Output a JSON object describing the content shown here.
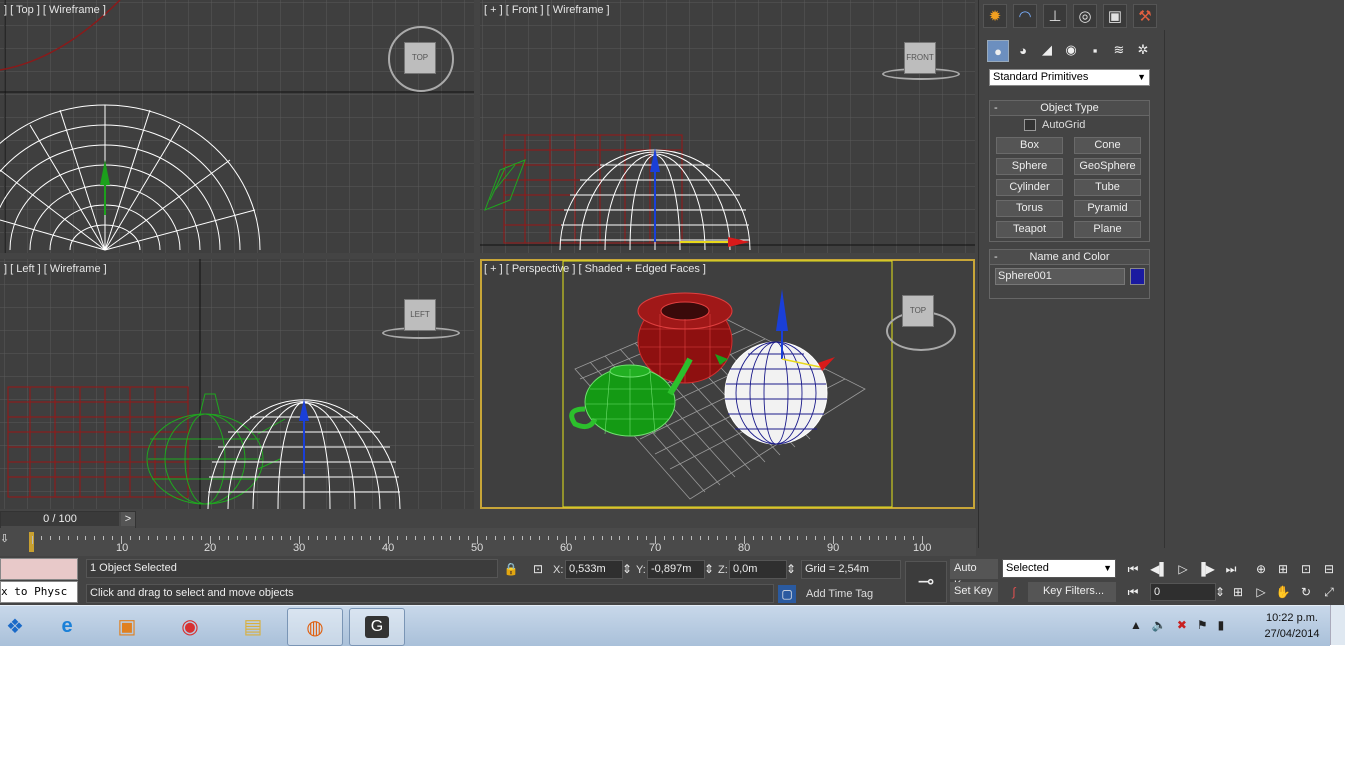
{
  "viewports": {
    "top": {
      "label": "] [ Top ] [ Wireframe ]",
      "cube": "TOP"
    },
    "front": {
      "label": "[ + ] [ Front ] [ Wireframe ]",
      "cube": "FRONT"
    },
    "left": {
      "label": "] [ Left ] [ Wireframe ]",
      "cube": "LEFT"
    },
    "perspective": {
      "label": "[ + ] [ Perspective ] [ Shaded + Edged Faces ]",
      "cube": "TOP"
    }
  },
  "command_panel": {
    "tabs": [
      "create-icon",
      "modify-icon",
      "hierarchy-icon",
      "motion-icon",
      "display-icon",
      "utilities-icon"
    ],
    "subtabs": [
      "geometry-icon",
      "shapes-icon",
      "lights-icon",
      "cameras-icon",
      "helpers-icon",
      "spacewarps-icon",
      "systems-icon"
    ],
    "dropdown": "Standard Primitives",
    "object_type": {
      "title": "Object Type",
      "autogrid": "AutoGrid",
      "buttons": [
        "Box",
        "Cone",
        "Sphere",
        "GeoSphere",
        "Cylinder",
        "Tube",
        "Torus",
        "Pyramid",
        "Teapot",
        "Plane"
      ]
    },
    "name_color": {
      "title": "Name and Color",
      "name": "Sphere001",
      "color": "#1a1aa0"
    }
  },
  "timeline": {
    "slider": "0 / 100",
    "next": ">",
    "labels": [
      "10",
      "20",
      "30",
      "40",
      "50",
      "60",
      "70",
      "80",
      "90",
      "100"
    ]
  },
  "status": {
    "script": "x to Physc",
    "selected": "1 Object Selected",
    "prompt": "Click and drag to select and move objects",
    "x_label": "X:",
    "x": "0,533m",
    "y_label": "Y:",
    "y": "-0,897m",
    "z_label": "Z:",
    "z": "0,0m",
    "grid": "Grid = 2,54m",
    "add_time_tag": "Add Time Tag",
    "auto_key": "Auto Key",
    "set_key": "Set Key",
    "key_mode": "Selected",
    "key_filters": "Key Filters...",
    "frame": "0"
  },
  "taskbar": {
    "apps": [
      "start-icon",
      "ie-icon",
      "media-icon",
      "chrome-icon",
      "explorer-icon",
      "firefox-icon",
      "3dsmax-icon"
    ],
    "time": "10:22 p.m.",
    "date": "27/04/2014"
  }
}
